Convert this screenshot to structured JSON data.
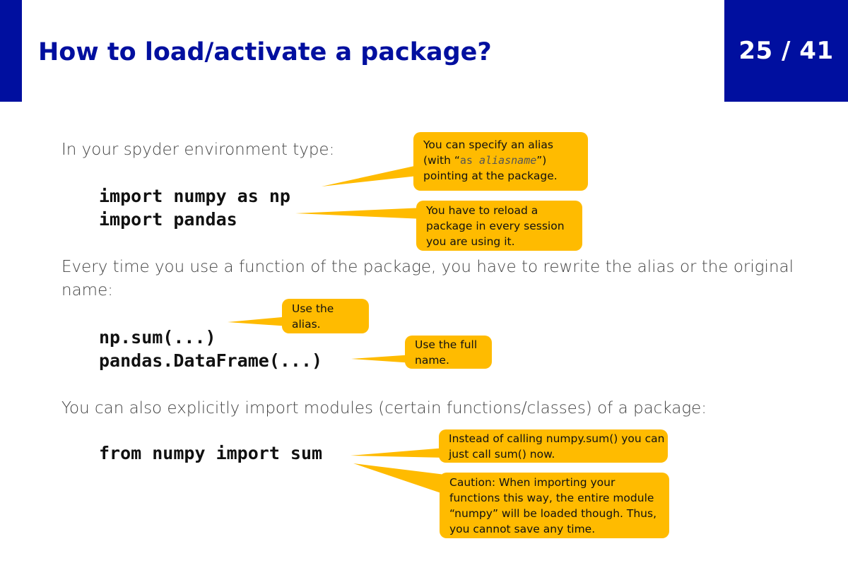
{
  "header": {
    "title": "How to load/activate a package?",
    "page_number": "25 / 41"
  },
  "colors": {
    "brand": "#000f9f",
    "callout": "#ffbb00"
  },
  "section1": {
    "intro": "In your spyder environment type:",
    "code": [
      "import numpy as np",
      "import pandas"
    ]
  },
  "section2": {
    "intro_line1": "Every time you use a function of the package, you have to rewrite the alias or the original",
    "intro_line2": "name:",
    "code": [
      "np.sum(...)",
      "pandas.DataFrame(...)"
    ]
  },
  "section3": {
    "intro": "You can also explicitly import modules (certain functions/classes) of a package:",
    "code": [
      "from numpy import sum"
    ]
  },
  "callouts": {
    "alias": {
      "line1": "You can specify an alias",
      "line2_pre": "(with “",
      "line2_code": "as ",
      "line2_italic": "aliasname",
      "line2_post": "”)",
      "line3": "pointing at the package."
    },
    "reload": [
      "You have to reload a",
      "package in every session",
      "you are using it."
    ],
    "use_alias": [
      "Use the",
      "alias."
    ],
    "use_full": [
      "Use the full",
      "name."
    ],
    "instead": [
      "Instead of calling numpy.sum() you can",
      "just call sum() now."
    ],
    "caution": [
      "Caution: When importing your",
      "functions this way, the entire module",
      "“numpy” will be loaded though. Thus,",
      "you cannot save any time."
    ]
  }
}
